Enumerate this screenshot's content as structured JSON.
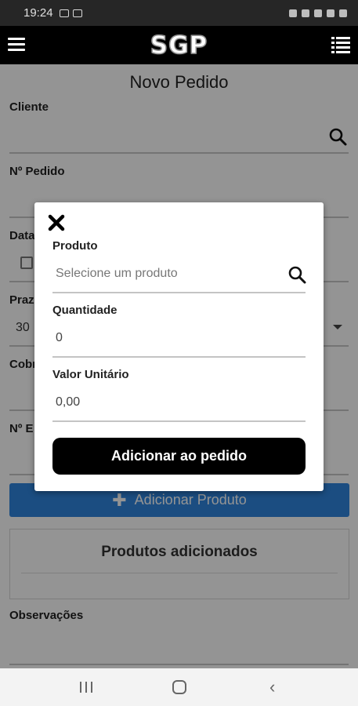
{
  "status_bar": {
    "time": "19:24"
  },
  "header": {
    "logo": "SGP"
  },
  "form": {
    "title": "Novo Pedido",
    "cliente_label": "Cliente",
    "pedido_label": "Nº Pedido",
    "data_label": "Data",
    "prazo_label": "Prazo",
    "prazo_value": "30",
    "cobranca_label": "Cobr",
    "entrega_label": "Nº E",
    "add_product_label": "Adicionar Produto",
    "products_title": "Produtos adicionados",
    "observacoes_label": "Observações"
  },
  "modal": {
    "produto_label": "Produto",
    "produto_placeholder": "Selecione um produto",
    "quantidade_label": "Quantidade",
    "quantidade_value": "0",
    "valor_label": "Valor Unitário",
    "valor_value": "0,00",
    "submit_label": "Adicionar ao pedido"
  },
  "icons": {
    "menu": "hamburger-icon",
    "list": "list-icon",
    "search": "search-icon",
    "close": "close-icon",
    "plus": "plus-icon",
    "calendar": "calendar-icon"
  },
  "colors": {
    "header_bg": "#000000",
    "primary_button": "#2f86df",
    "modal_button": "#000000",
    "status_bar": "#262626"
  }
}
